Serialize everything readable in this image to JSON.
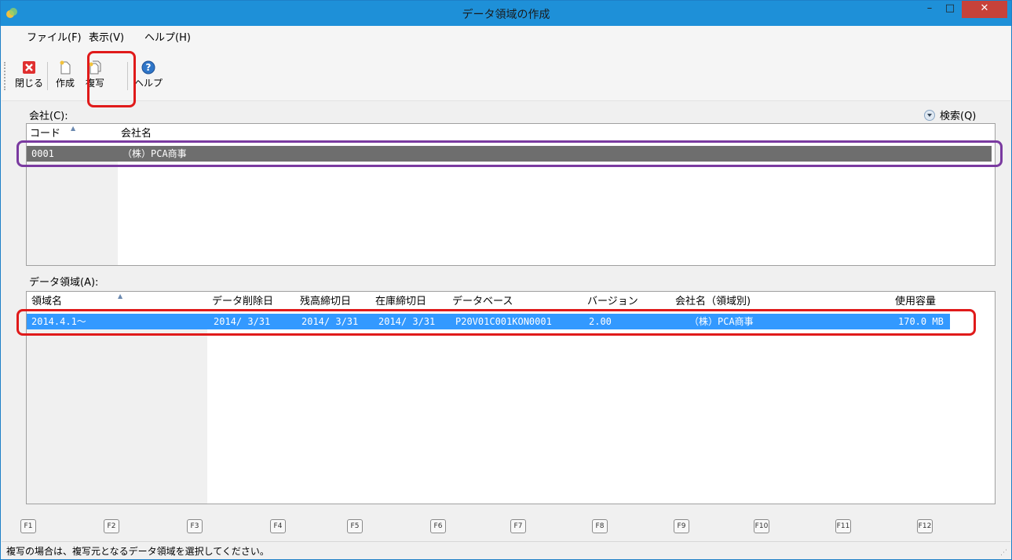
{
  "window": {
    "title": "データ領域の作成",
    "min": "–",
    "max": "□",
    "close": "✕"
  },
  "menu": [
    "ファイル(F)",
    "表示(V)",
    "ヘルプ(H)"
  ],
  "toolbar": {
    "close": "閉じる",
    "create": "作成",
    "copy": "複写",
    "help": "ヘルプ"
  },
  "company": {
    "label": "会社(C):",
    "search": "検索(Q)",
    "columns": [
      "コード",
      "会社名"
    ],
    "rows": [
      {
        "code": "0001",
        "name": "（株）PCA商事"
      }
    ]
  },
  "area": {
    "label": "データ領域(A):",
    "columns": [
      "領域名",
      "データ削除日",
      "残高締切日",
      "在庫締切日",
      "データベース",
      "バージョン",
      "会社名（領域別)",
      "使用容量"
    ],
    "rows": [
      {
        "name": "2014.4.1～",
        "delete_date": "2014/ 3/31",
        "balance_date": "2014/ 3/31",
        "stock_date": "2014/ 3/31",
        "database": "P20V01C001KON0001",
        "version": "2.00",
        "company": "（株）PCA商事",
        "size": "170.0 MB"
      }
    ]
  },
  "fkeys": [
    "F1",
    "F2",
    "F3",
    "F4",
    "F5",
    "F6",
    "F7",
    "F8",
    "F9",
    "F10",
    "F11",
    "F12"
  ],
  "status": "複写の場合は、複写元となるデータ領域を選択してください。",
  "colors": {
    "titlebar": "#1e90d8",
    "selected_dark": "#6e6e6e",
    "selected_blue": "#3399ff",
    "highlight_red": "#e01a1a",
    "highlight_purple": "#7a3aa0"
  }
}
